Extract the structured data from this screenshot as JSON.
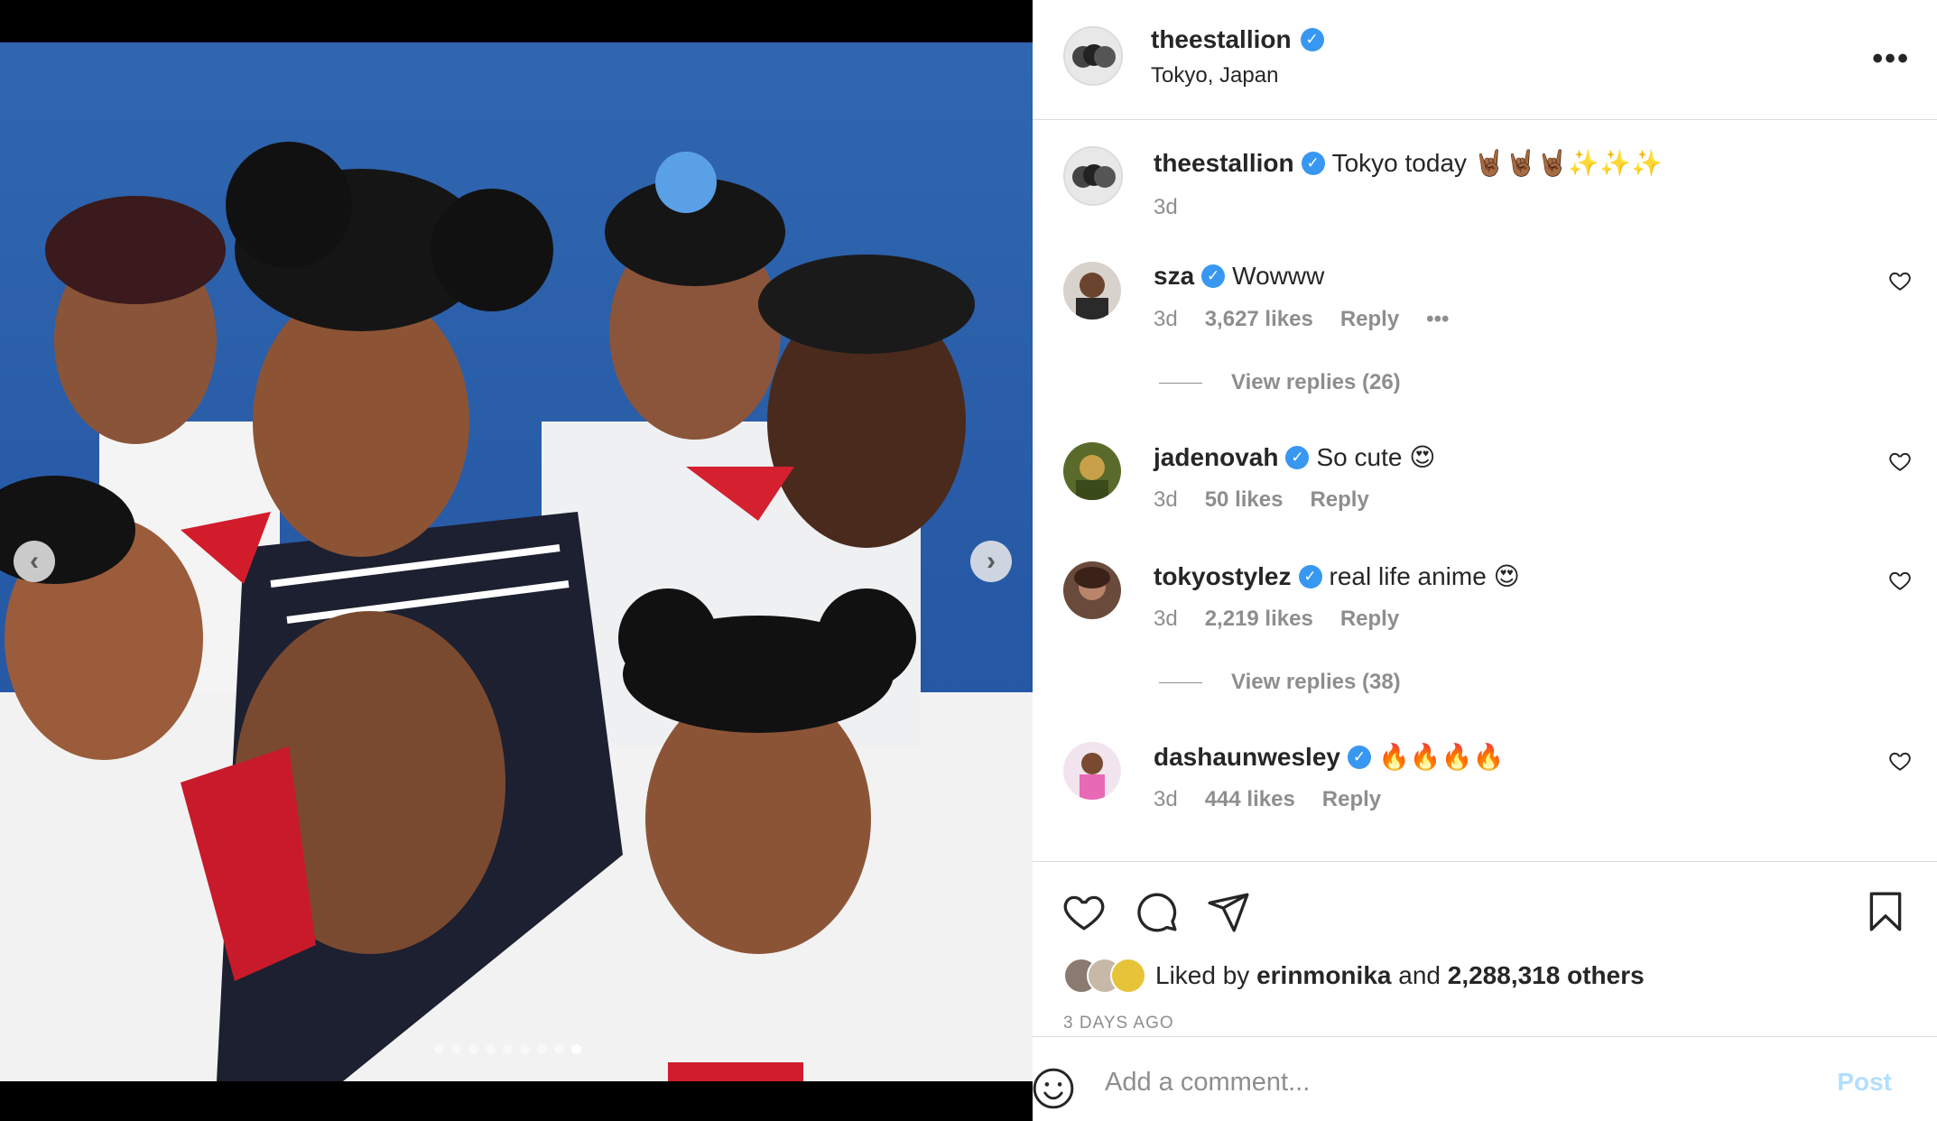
{
  "post": {
    "username": "theestallion",
    "location": "Tokyo, Japan",
    "caption": "Tokyo today 🤘🏾🤘🏾🤘🏾✨✨✨",
    "caption_age": "3d",
    "photo_count": 9,
    "active_photo_index": 8
  },
  "comments": [
    {
      "username": "sza",
      "text": "Wowww",
      "age": "3d",
      "likes": "3,627 likes",
      "reply": "Reply",
      "more": "•••",
      "replies": "View replies (26)"
    },
    {
      "username": "jadenovah",
      "text": "So cute 😍",
      "age": "3d",
      "likes": "50 likes",
      "reply": "Reply"
    },
    {
      "username": "tokyostylez",
      "text": "real life anime 😍",
      "age": "3d",
      "likes": "2,219 likes",
      "reply": "Reply",
      "replies": "View replies (38)"
    },
    {
      "username": "dashaunwesley",
      "text": "🔥🔥🔥🔥",
      "age": "3d",
      "likes": "444 likes",
      "reply": "Reply"
    }
  ],
  "likes": {
    "prefix": "Liked by",
    "first_user": "erinmonika",
    "middle": "and",
    "others": "2,288,318 others"
  },
  "date_label": "3 DAYS AGO",
  "add_comment": {
    "placeholder": "Add a comment...",
    "post_label": "Post"
  },
  "icons": {
    "verified": "✓",
    "prev": "‹",
    "next": "›"
  },
  "colors": {
    "verified": "#3897f0",
    "post_disabled": "#b2dffc",
    "secondary_text": "#8e8e8e"
  }
}
